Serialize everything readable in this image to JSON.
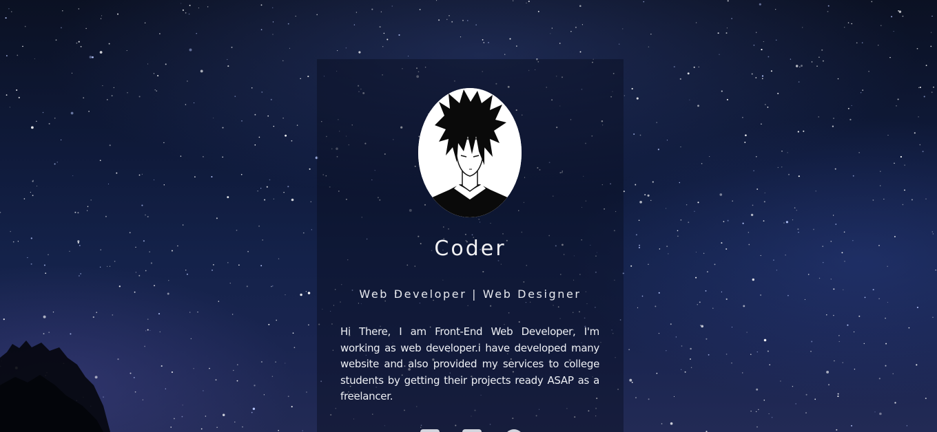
{
  "profile": {
    "name": "Coder",
    "role": "Web Developer | Web Designer",
    "bio": "Hi There, I am Front-End Web Developer, I'm working as web developer.i have developed many website and also provided my services to college students by getting their projects ready ASAP as a freelancer."
  },
  "avatar": {
    "icon": "anime-boy-portrait"
  },
  "social": {
    "icons": [
      "facebook-icon",
      "twitter-icon",
      "github-icon"
    ]
  },
  "colors": {
    "background": "#0f1a3a",
    "card": "#080e20",
    "text": "#f2f2f4"
  }
}
